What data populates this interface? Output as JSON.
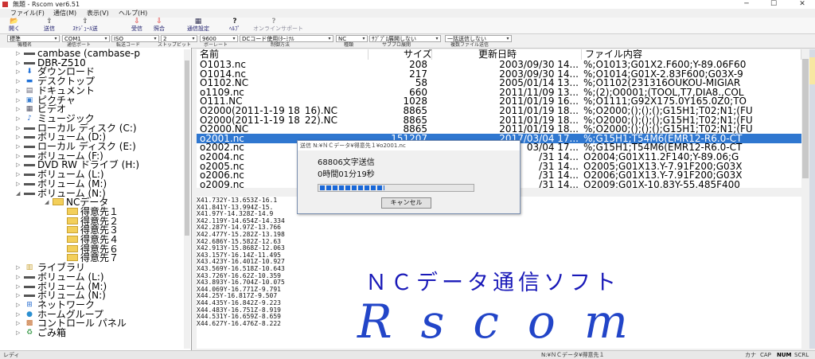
{
  "window": {
    "title": "無題 - Rscom ver6.51",
    "minimize": "─",
    "maximize": "☐",
    "close": "✕"
  },
  "menu": [
    "ファイル(F)",
    "通信(M)",
    "表示(V)",
    "ヘルプ(H)"
  ],
  "toolbar": [
    {
      "icon": "open-icon",
      "glyph": "📂",
      "label": "開く"
    },
    {
      "icon": "send-icon",
      "glyph": "⇧",
      "label": "送信"
    },
    {
      "icon": "schedule-icon",
      "glyph": "⇧",
      "label": "ｽｹｼﾞｭｰﾙ送"
    },
    {
      "icon": "receive-icon",
      "glyph": "⇩",
      "label": "受信"
    },
    {
      "icon": "compare-icon",
      "glyph": "⇩",
      "label": "照合"
    },
    {
      "icon": "comm-settings-icon",
      "glyph": "▦",
      "label": "通信設定"
    },
    {
      "icon": "help-icon",
      "glyph": "?",
      "label": "ﾍﾙﾌﾟ"
    },
    {
      "icon": "online-help-icon",
      "glyph": "?",
      "label": "オンラインサポート"
    }
  ],
  "settings": [
    {
      "value": "標準",
      "label": "機種名"
    },
    {
      "value": "COM1",
      "label": "通信ポート"
    },
    {
      "value": "ISO",
      "label": "転送コード"
    },
    {
      "value": "2",
      "label": "ストップビット"
    },
    {
      "value": "9600",
      "label": "ボーレート"
    },
    {
      "value": "DCコード使用(ﾀｰﾐﾅﾙ",
      "label": "制御方法"
    },
    {
      "value": "NC",
      "label": "種類"
    },
    {
      "value": "ｻﾌﾞﾌﾟﾛ展開しない",
      "label": "サブプロ展開"
    },
    {
      "value": "一括送信しない",
      "label": "複数ファイル送信"
    }
  ],
  "tree": [
    {
      "text": "cambase (cambase-p",
      "kind": "drive"
    },
    {
      "text": "DBR-Z510",
      "kind": "drive"
    },
    {
      "text": "ダウンロード",
      "kind": "down"
    },
    {
      "text": "デスクトップ",
      "kind": "desk"
    },
    {
      "text": "ドキュメント",
      "kind": "doc"
    },
    {
      "text": "ピクチャ",
      "kind": "pic"
    },
    {
      "text": "ビデオ",
      "kind": "vid"
    },
    {
      "text": "ミュージック",
      "kind": "mus"
    },
    {
      "text": "ローカル ディスク (C:)",
      "kind": "drive"
    },
    {
      "text": "ボリューム (D:)",
      "kind": "drive"
    },
    {
      "text": "ローカル ディスク (E:)",
      "kind": "drive"
    },
    {
      "text": "ボリューム (F:)",
      "kind": "drive"
    },
    {
      "text": "DVD RW ドライブ (H:)",
      "kind": "drive"
    },
    {
      "text": "ボリューム (L:)",
      "kind": "drive"
    },
    {
      "text": "ボリューム (M:)",
      "kind": "drive"
    },
    {
      "text": "ボリューム (N:)",
      "kind": "drive"
    },
    {
      "text": "NCデータ",
      "kind": "folder"
    },
    {
      "text": "得意先１",
      "kind": "folder"
    },
    {
      "text": "得意先２",
      "kind": "folder"
    },
    {
      "text": "得意先３",
      "kind": "folder"
    },
    {
      "text": "得意先４",
      "kind": "folder"
    },
    {
      "text": "得意先６",
      "kind": "folder"
    },
    {
      "text": "得意先７",
      "kind": "folder"
    },
    {
      "text": "ライブラリ",
      "kind": "lib"
    },
    {
      "text": "ボリューム (L:)",
      "kind": "drive"
    },
    {
      "text": "ボリューム (M:)",
      "kind": "drive"
    },
    {
      "text": "ボリューム (N:)",
      "kind": "drive"
    },
    {
      "text": "ネットワーク",
      "kind": "net"
    },
    {
      "text": "ホームグループ",
      "kind": "home"
    },
    {
      "text": "コントロール パネル",
      "kind": "cp"
    },
    {
      "text": "ごみ箱",
      "kind": "trash"
    }
  ],
  "columns": [
    "名前",
    "サイズ",
    "更新日時",
    "ファイル内容"
  ],
  "files": [
    {
      "name": "O1013.nc",
      "size": "208",
      "date": "2003/09/30 14...",
      "content": "%;O1013;G01X2.F600;Y-89.06F60"
    },
    {
      "name": "O1014.nc",
      "size": "217",
      "date": "2003/09/30 14...",
      "content": "%;O1014;G01X-2.83F600;G03X-9"
    },
    {
      "name": "O1102.NC",
      "size": "58",
      "date": "2005/01/14 13...",
      "content": "%;O1102(231316OUKOU-MIGIAR"
    },
    {
      "name": "o1109.nc",
      "size": "660",
      "date": "2011/11/09 13...",
      "content": "%;(2);O0001;(TOOL,T7,DIA8.,COL"
    },
    {
      "name": "O111.NC",
      "size": "1028",
      "date": "2011/01/19 16...",
      "content": "%;O1111;G92X175.0Y165.0Z0;TO"
    },
    {
      "name": "O2000(2011-1-19 18_16).NC",
      "size": "8865",
      "date": "2011/01/19 18...",
      "content": "%;O2000;();();();G15H1;T02;N1;(FU"
    },
    {
      "name": "O2000(2011-1-19 18_22).NC",
      "size": "8865",
      "date": "2011/01/19 18...",
      "content": "%;O2000;();();();G15H1;T02;N1;(FU"
    },
    {
      "name": "O2000.NC",
      "size": "8865",
      "date": "2011/01/19 18...",
      "content": "%;O2000;();();();G15H1;T02;N1;(FU"
    },
    {
      "name": "o2001.nc",
      "size": "151207",
      "date": "2017/03/04 17...",
      "content": "%;G15H1;T54M6(EMR12-R6.0-CT"
    },
    {
      "name": "o2002.nc",
      "size": "",
      "date": "03/04 17...",
      "content": "%;G15H1;T54M6(EMR12-R6.0-CT"
    },
    {
      "name": "o2004.nc",
      "size": "",
      "date": "/31 14...",
      "content": "O2004;G01X11.2F140;Y-89.06;G"
    },
    {
      "name": "o2005.nc",
      "size": "",
      "date": "/31 14...",
      "content": "O2005;G01X13.Y-7.91F200;G03X"
    },
    {
      "name": "o2006.nc",
      "size": "",
      "date": "/31 14...",
      "content": "O2006;G01X13.Y-7.91F200;G03X"
    },
    {
      "name": "o2009.nc",
      "size": "",
      "date": "/31 14...",
      "content": "O2009;G01X-10.83Y-55.485F400"
    }
  ],
  "nc_lines": [
    "X41.732Y-13.653Z-16.1",
    "X41.841Y-13.994Z-15.",
    "X41.97Y-14.328Z-14.9",
    "X42.119Y-14.654Z-14.334",
    "X42.287Y-14.97Z-13.766",
    "X42.477Y-15.282Z-13.198",
    "X42.686Y-15.582Z-12.63",
    "X42.913Y-15.868Z-12.063",
    "X43.157Y-16.14Z-11.495",
    "X43.423Y-16.401Z-10.927",
    "X43.569Y-16.518Z-10.643",
    "X43.726Y-16.62Z-10.359",
    "X43.893Y-16.704Z-10.075",
    "X44.069Y-16.771Z-9.791",
    "X44.25Y-16.817Z-9.507",
    "X44.435Y-16.842Z-9.223",
    "X44.483Y-16.751Z-8.919",
    "X44.531Y-16.659Z-8.659",
    "X44.627Y-16.476Z-8.222"
  ],
  "banner": {
    "title": "ＮＣデータ通信ソフト",
    "logo": "Rscom"
  },
  "dialog": {
    "title": "送信 N:¥ＮＣデータ¥得意先１¥o2001.nc",
    "line1": "68806文字送信",
    "line2": "0時間01分19秒",
    "progress": 0.42,
    "cancel": "キャンセル"
  },
  "status": {
    "left": "レディ",
    "path": "N:¥ＮＣデータ¥得意先１",
    "kana": "カナ",
    "cap": "CAP",
    "num": "NUM",
    "scrl": "SCRL"
  },
  "colors": {
    "selection": "#2f77d0",
    "banner": "#1919b8",
    "progress": "#1a68d8"
  }
}
